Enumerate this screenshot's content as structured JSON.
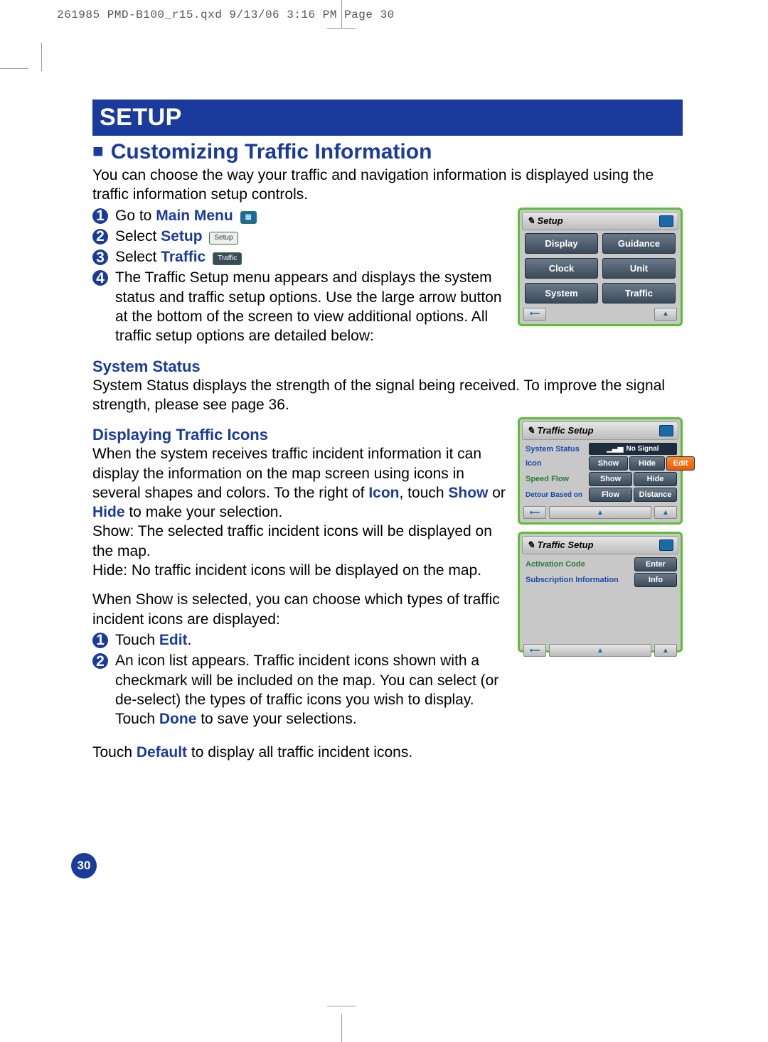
{
  "slugline": "261985 PMD-B100_r15.qxd  9/13/06  3:16 PM  Page 30",
  "banner": "SETUP",
  "heading": "Customizing Traffic Information",
  "intro": "You can choose the way your traffic and navigation information is displayed using the traffic information setup controls.",
  "steps": {
    "s1_pre": "Go to ",
    "s1_link": "Main Menu",
    "s2_pre": "Select ",
    "s2_link": "Setup",
    "s3_pre": "Select ",
    "s3_link": "Traffic",
    "s4": "The Traffic Setup menu appears and displays the system status and traffic setup options. Use the large arrow button at the bottom of the screen to view additional options. All traffic setup options are detailed below:"
  },
  "sub1": "System Status",
  "sub1_text": "System Status displays the strength of the signal being received. To improve the signal strength, please see page 36.",
  "sub2": "Displaying Traffic Icons",
  "sub2_p1a": "When the system receives traffic incident information it can display the information on the map screen using icons in several shapes and colors.  To the right of ",
  "sub2_p1_icon": "Icon",
  "sub2_p1b": ", touch ",
  "sub2_p1_show": "Show",
  "sub2_p1c": " or ",
  "sub2_p1_hide": "Hide",
  "sub2_p1d": " to make your selection.",
  "sub2_show": "Show: The selected traffic incident icons will be displayed on the map.",
  "sub2_hide": "Hide: No traffic incident icons will be displayed on the map.",
  "sub2_when": "When Show is selected, you can choose which types of traffic incident icons are displayed:",
  "edit_steps": {
    "e1_pre": "Touch ",
    "e1_link": "Edit",
    "e1_post": ".",
    "e2a": "An icon list appears. Traffic incident icons shown with a checkmark will be included on the map. You can select (or de-select) the types of traffic icons you wish to display.",
    "e2b_pre": "Touch ",
    "e2b_link": "Done",
    "e2b_post": " to save your selections."
  },
  "final_pre": "Touch ",
  "final_link": "Default",
  "final_post": " to display all traffic incident icons.",
  "page_num": "30",
  "inline_icons": {
    "menu": "▦",
    "setup": "Setup",
    "traffic": "Traffic"
  },
  "scr_setup": {
    "title": "Setup",
    "buttons": [
      "Display",
      "Guidance",
      "Clock",
      "Unit",
      "System",
      "Traffic"
    ]
  },
  "scr_traffic1": {
    "title": "Traffic Setup",
    "rows": {
      "status_label": "System Status",
      "status_value": "No Signal",
      "icon_label": "Icon",
      "icon_show": "Show",
      "icon_hide": "Hide",
      "icon_edit": "Edit",
      "flow_label": "Speed Flow",
      "flow_show": "Show",
      "flow_hide": "Hide",
      "detour_label": "Detour Based on",
      "detour_flow": "Flow",
      "detour_dist": "Distance"
    }
  },
  "scr_traffic2": {
    "title": "Traffic Setup",
    "act_label": "Activation Code",
    "act_btn": "Enter",
    "sub_label": "Subscription Information",
    "sub_btn": "Info"
  }
}
